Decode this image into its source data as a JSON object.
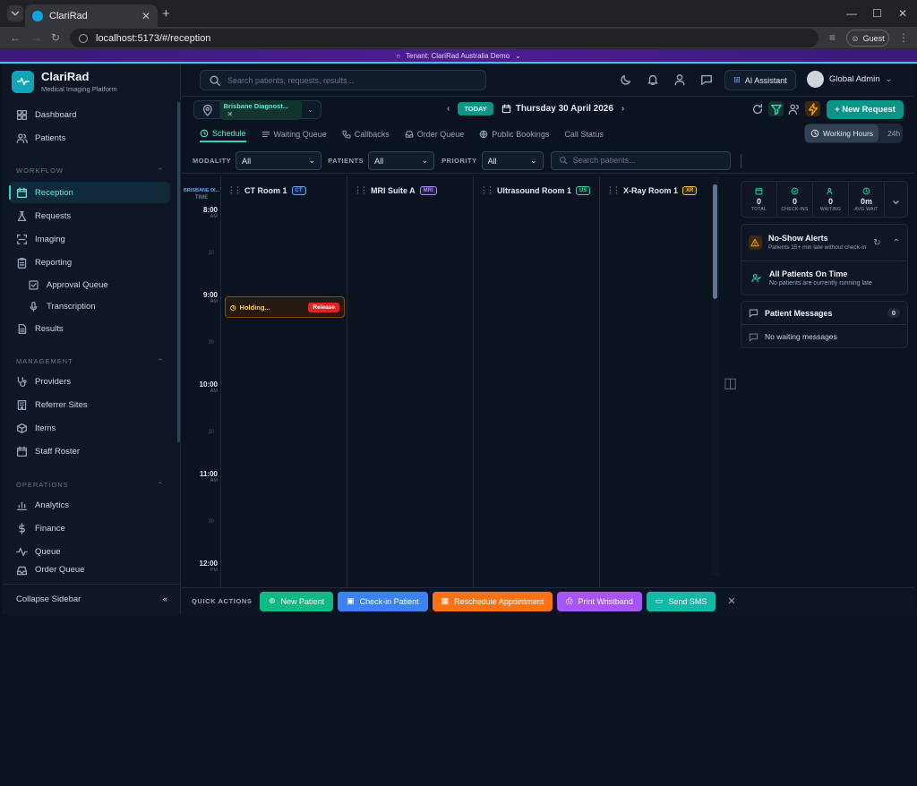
{
  "browser": {
    "tab_title": "ClariRad",
    "url": "localhost:5173/#/reception",
    "profile": "Guest"
  },
  "banner": {
    "text": "Tenant: ClariRad Australia Demo"
  },
  "app": {
    "name": "ClariRad",
    "tagline": "Medical Imaging Platform"
  },
  "sidebar": {
    "top": [
      {
        "label": "Dashboard",
        "icon": "dashboard-icon"
      },
      {
        "label": "Patients",
        "icon": "users-icon"
      }
    ],
    "sections": {
      "workflow": "WORKFLOW",
      "management": "MANAGEMENT",
      "operations": "OPERATIONS"
    },
    "workflow": [
      {
        "label": "Reception",
        "icon": "reception-icon",
        "active": true
      },
      {
        "label": "Requests",
        "icon": "flask-icon"
      },
      {
        "label": "Imaging",
        "icon": "scan-icon"
      },
      {
        "label": "Reporting",
        "icon": "clipboard-icon"
      },
      {
        "label": "Approval Queue",
        "icon": "check-square-icon",
        "sub": true
      },
      {
        "label": "Transcription",
        "icon": "mic-icon",
        "sub": true
      },
      {
        "label": "Results",
        "icon": "document-icon"
      }
    ],
    "management": [
      {
        "label": "Providers",
        "icon": "stethoscope-icon"
      },
      {
        "label": "Referrer Sites",
        "icon": "building-icon"
      },
      {
        "label": "Items",
        "icon": "box-icon"
      },
      {
        "label": "Staff Roster",
        "icon": "calendar-icon"
      }
    ],
    "operations": [
      {
        "label": "Analytics",
        "icon": "chart-icon"
      },
      {
        "label": "Finance",
        "icon": "dollar-icon"
      },
      {
        "label": "Queue",
        "icon": "activity-icon"
      },
      {
        "label": "Order Queue",
        "icon": "inbox-icon"
      }
    ],
    "collapse_label": "Collapse Sidebar"
  },
  "header": {
    "search_placeholder": "Search patients, requests, results...",
    "ai_label": "AI Assistant",
    "user_name": "Global Admin"
  },
  "toolbar": {
    "site": "Brisbane Diagnost...",
    "today_label": "TODAY",
    "date": "Thursday 30 April 2026",
    "new_request": "+ New Request",
    "tabs": [
      "Schedule",
      "Waiting Queue",
      "Callbacks",
      "Order Queue",
      "Public Bookings",
      "Call Status"
    ],
    "working_hours": "Working Hours",
    "h24": "24h"
  },
  "filters": {
    "modality_label": "MODALITY",
    "modality_value": "All",
    "patients_label": "PATIENTS",
    "patients_value": "All",
    "priority_label": "PRIORITY",
    "priority_value": "All",
    "search_placeholder": "Search patients..."
  },
  "schedule": {
    "site_short": "BRISBANE DI...",
    "time_header": "TIME",
    "hours": [
      {
        "time": "8:00",
        "ampm": "AM"
      },
      {
        "time": "9:00",
        "ampm": "AM"
      },
      {
        "time": "10:00",
        "ampm": "AM"
      },
      {
        "time": "11:00",
        "ampm": "AM"
      },
      {
        "time": "12:00",
        "ampm": "PM"
      }
    ],
    "half": "30",
    "rooms": [
      {
        "name": "CT Room 1",
        "tag": "CT",
        "tag_color": "#60a5fa"
      },
      {
        "name": "MRI Suite A",
        "tag": "MRI",
        "tag_color": "#a78bfa"
      },
      {
        "name": "Ultrasound Room 1",
        "tag": "US",
        "tag_color": "#34d399"
      },
      {
        "name": "X-Ray Room 1",
        "tag": "XR",
        "tag_color": "#fbbf24"
      }
    ],
    "holding": {
      "label": "Holding...",
      "action": "Release"
    }
  },
  "stats": [
    {
      "value": "0",
      "label": "TOTAL",
      "icon": "calendar-icon"
    },
    {
      "value": "0",
      "label": "CHECK-INS",
      "icon": "check-circle-icon"
    },
    {
      "value": "0",
      "label": "WAITING",
      "icon": "users-icon"
    },
    {
      "value": "0m",
      "label": "AVG WAIT",
      "icon": "clock-icon"
    }
  ],
  "noshow": {
    "title": "No-Show Alerts",
    "subtitle": "Patients 15+ min late without check-in",
    "ok_title": "All Patients On Time",
    "ok_sub": "No patients are currently running late"
  },
  "messages": {
    "title": "Patient Messages",
    "count": "0",
    "empty": "No waiting messages"
  },
  "quick_actions": {
    "label": "QUICK ACTIONS",
    "buttons": [
      {
        "label": "New Patient",
        "color": "#10b981"
      },
      {
        "label": "Check-in Patient",
        "color": "#3b82f6"
      },
      {
        "label": "Reschedule Appointment",
        "color": "#f97316"
      },
      {
        "label": "Print Wristband",
        "color": "#a855f7"
      },
      {
        "label": "Send SMS",
        "color": "#14b8a6"
      }
    ]
  }
}
